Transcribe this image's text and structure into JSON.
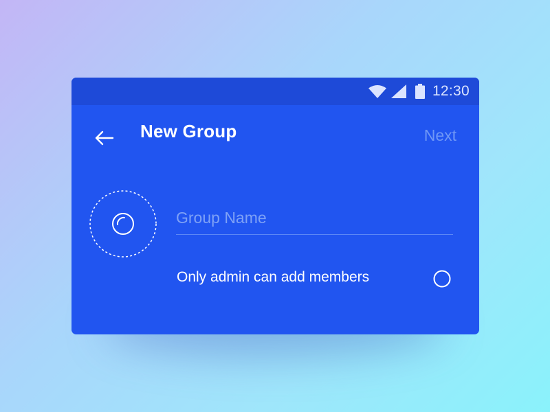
{
  "status_bar": {
    "time": "12:30",
    "icons": [
      "wifi-icon",
      "signal-icon",
      "battery-icon"
    ]
  },
  "header": {
    "back_icon": "arrow-left-icon",
    "title": "New Group",
    "next_label": "Next"
  },
  "form": {
    "photo_picker_icon": "camera-lens-icon",
    "group_name": {
      "value": "",
      "placeholder": "Group Name"
    },
    "admin_only": {
      "label": "Only admin can add members",
      "checked": false
    }
  },
  "colors": {
    "card": "#2155f0",
    "status_bar": "#1e4ad8",
    "next_disabled": "#6f97f6",
    "placeholder": "#7ea1f6"
  }
}
